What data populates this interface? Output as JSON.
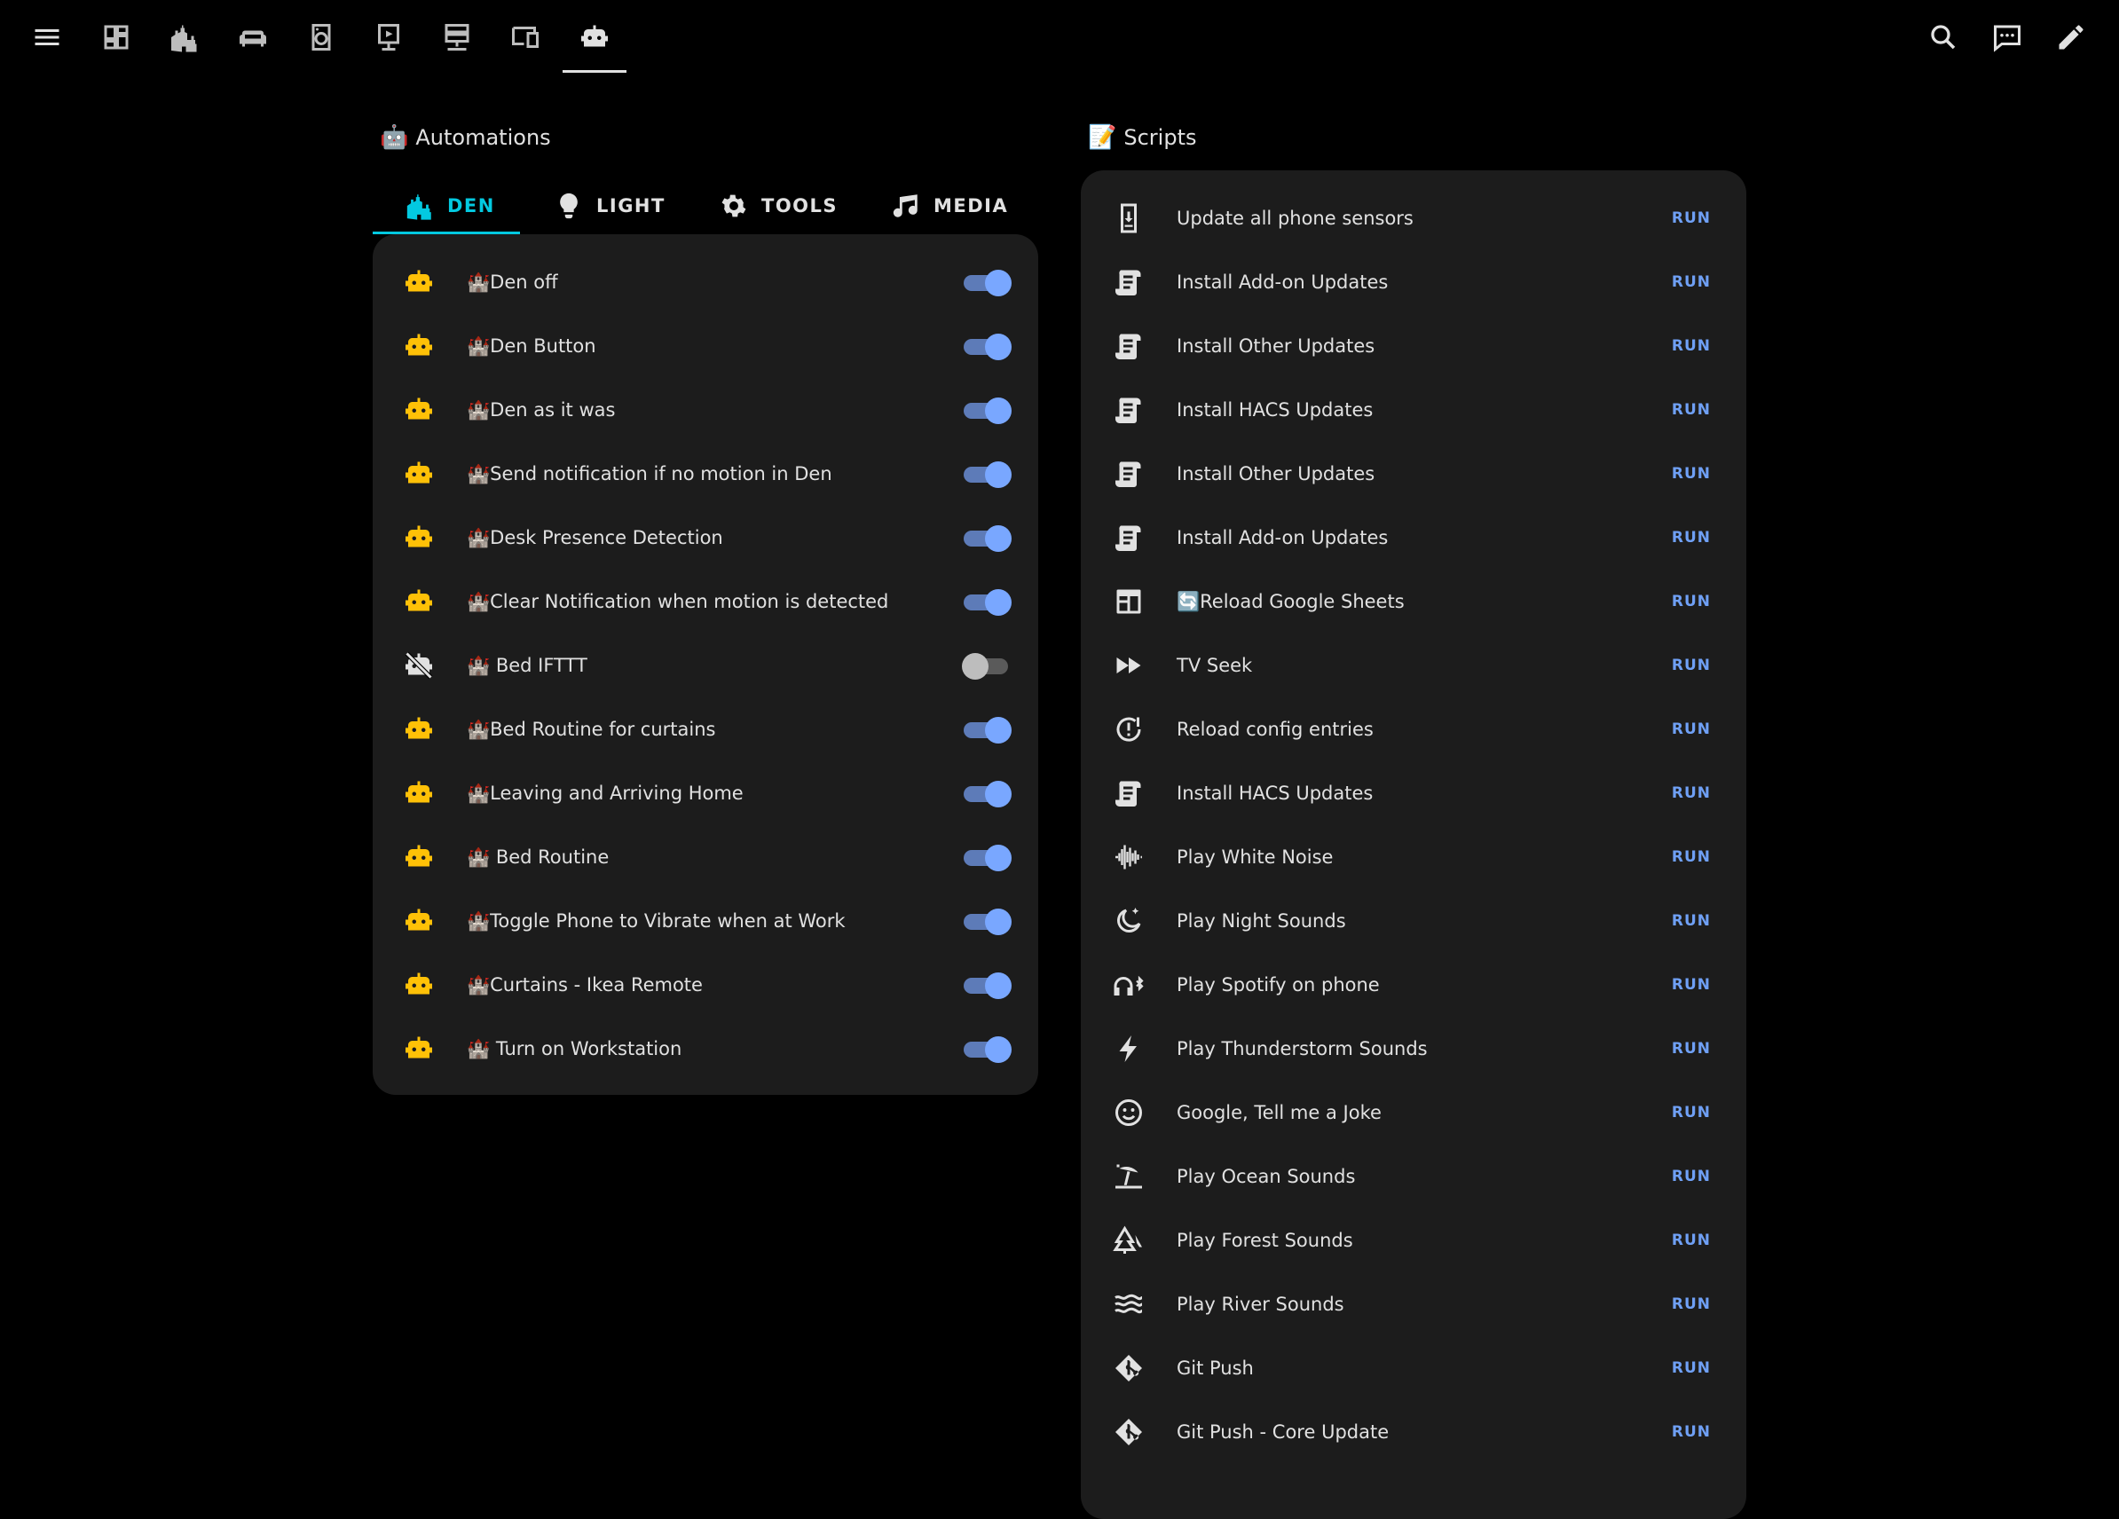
{
  "colors": {
    "accent": "#03c9e0",
    "robot": "#ffc107",
    "run": "#6fa0f5",
    "card": "#1c1c1c"
  },
  "topbar": {
    "nav_icons": [
      "menu-icon",
      "dashboard-icon",
      "castle-icon",
      "sofa-icon",
      "washer-icon",
      "theater-icon",
      "server-icon",
      "devices-icon",
      "robot-icon"
    ],
    "right_icons": [
      "search-icon",
      "chat-icon",
      "pencil-icon"
    ]
  },
  "automations": {
    "title_emoji": "🤖",
    "title": "Automations",
    "tabs": [
      {
        "label": "DEN",
        "icon": "castle-icon"
      },
      {
        "label": "LIGHT",
        "icon": "lightbulb-icon"
      },
      {
        "label": "TOOLS",
        "icon": "gear-icon"
      },
      {
        "label": "MEDIA",
        "icon": "music-icon"
      }
    ],
    "items": [
      {
        "label": "🏰Den off",
        "on": true
      },
      {
        "label": "🏰Den Button",
        "on": true
      },
      {
        "label": "🏰Den as it was",
        "on": true
      },
      {
        "label": "🏰Send notification if no motion in Den",
        "on": true
      },
      {
        "label": "🏰Desk Presence Detection",
        "on": true
      },
      {
        "label": "🏰Clear Notification when motion is detected",
        "on": true
      },
      {
        "label": "🏰 Bed IFTTT",
        "on": false
      },
      {
        "label": "🏰Bed Routine for curtains",
        "on": true
      },
      {
        "label": "🏰Leaving and Arriving Home",
        "on": true
      },
      {
        "label": "🏰 Bed Routine",
        "on": true
      },
      {
        "label": "🏰Toggle Phone to Vibrate when at Work",
        "on": true
      },
      {
        "label": "🏰Curtains - Ikea Remote",
        "on": true
      },
      {
        "label": "🏰 Turn on Workstation",
        "on": true
      }
    ]
  },
  "scripts": {
    "title_emoji": "📝",
    "title": "Scripts",
    "run_label": "RUN",
    "items": [
      {
        "label": "Update all phone sensors",
        "icon": "phone-download-icon"
      },
      {
        "label": "Install Add-on Updates",
        "icon": "script-icon"
      },
      {
        "label": "Install Other Updates",
        "icon": "script-icon"
      },
      {
        "label": "Install HACS Updates",
        "icon": "script-icon"
      },
      {
        "label": "Install Other Updates",
        "icon": "script-icon"
      },
      {
        "label": "Install Add-on Updates",
        "icon": "script-icon"
      },
      {
        "label": "🔄Reload Google Sheets",
        "icon": "table-icon"
      },
      {
        "label": "TV Seek",
        "icon": "fast-forward-icon"
      },
      {
        "label": "Reload config entries",
        "icon": "clock-alert-icon"
      },
      {
        "label": "Install HACS Updates",
        "icon": "script-icon"
      },
      {
        "label": "Play White Noise",
        "icon": "waveform-icon"
      },
      {
        "label": "Play Night Sounds",
        "icon": "moon-icon"
      },
      {
        "label": "Play Spotify on phone",
        "icon": "headphones-bluetooth-icon"
      },
      {
        "label": "Play Thunderstorm Sounds",
        "icon": "lightning-icon"
      },
      {
        "label": "Google, Tell me a Joke",
        "icon": "smiley-icon"
      },
      {
        "label": "Play Ocean Sounds",
        "icon": "beach-icon"
      },
      {
        "label": "Play Forest Sounds",
        "icon": "pine-tree-icon"
      },
      {
        "label": "Play River Sounds",
        "icon": "waves-icon"
      },
      {
        "label": "Git Push",
        "icon": "git-icon"
      },
      {
        "label": "Git Push - Core Update",
        "icon": "git-icon"
      }
    ]
  }
}
